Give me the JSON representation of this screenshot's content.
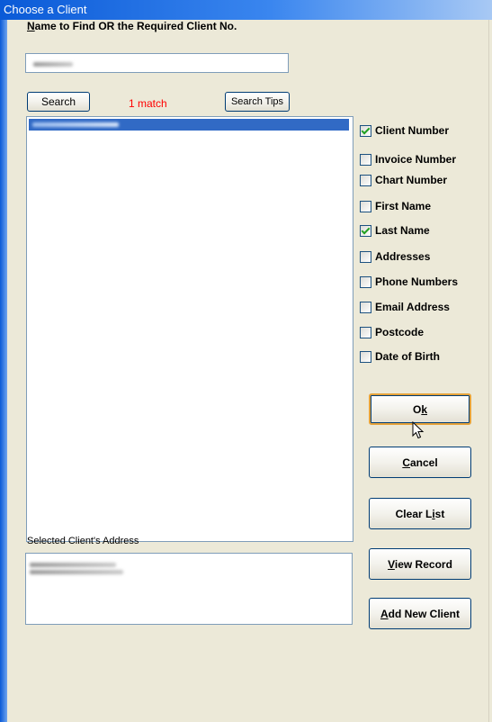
{
  "window": {
    "title": "Choose a Client"
  },
  "search": {
    "label_prefix": "N",
    "label_rest": "ame to Find OR the Required Client No.",
    "search_button": "Search",
    "match_text": "1 match",
    "tips_button": "Search Tips"
  },
  "options": [
    {
      "label": "Client Number",
      "checked": true
    },
    {
      "label": "Invoice Number",
      "checked": false
    },
    {
      "label": "Chart Number",
      "checked": false
    },
    {
      "label": "First Name",
      "checked": false
    },
    {
      "label": "Last Name",
      "checked": true
    },
    {
      "label": "Addresses",
      "checked": false
    },
    {
      "label": "Phone Numbers",
      "checked": false
    },
    {
      "label": "Email Address",
      "checked": false
    },
    {
      "label": "Postcode",
      "checked": false
    },
    {
      "label": "Date of Birth",
      "checked": false
    }
  ],
  "buttons": {
    "ok": "Ok",
    "cancel": "Cancel",
    "clear_list": "Clear List",
    "view_record": "View Record",
    "add_new_client": "Add New Client"
  },
  "address": {
    "label": "Selected Client's Address"
  },
  "colors": {
    "match_text": "#ff0000",
    "selection": "#316ac5",
    "check": "#21a121"
  },
  "icons": {
    "cursor": "arrow-cursor-icon",
    "check": "checkmark-icon"
  }
}
